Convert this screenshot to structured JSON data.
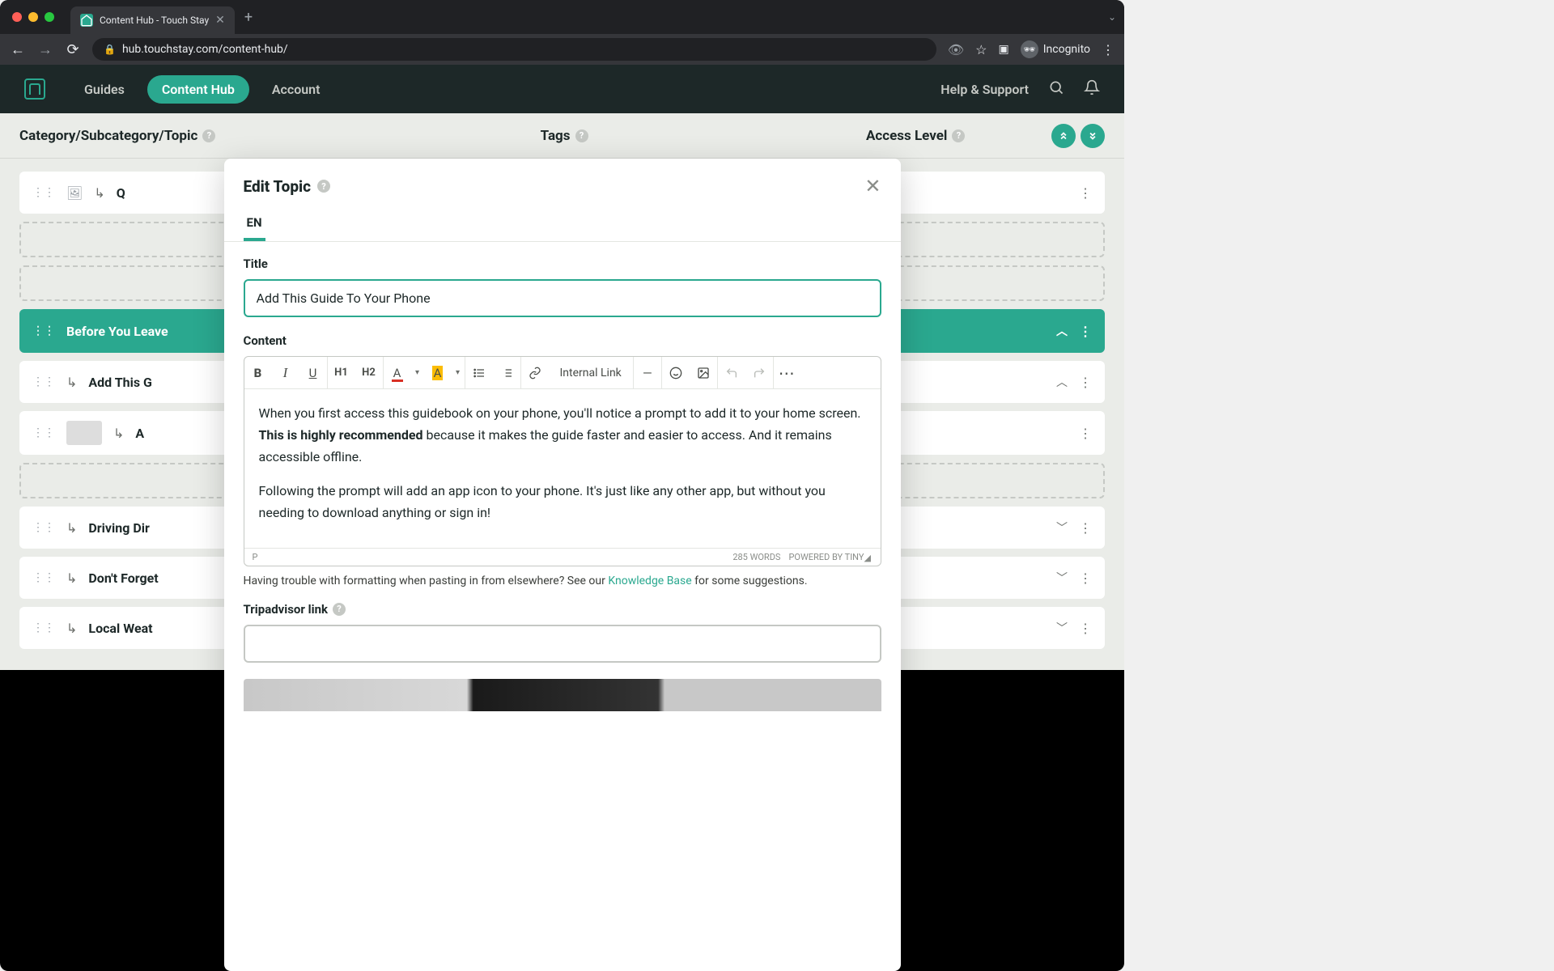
{
  "browser": {
    "tab_title": "Content Hub - Touch Stay",
    "url": "hub.touchstay.com/content-hub/",
    "incognito_label": "Incognito"
  },
  "nav": {
    "guides": "Guides",
    "content_hub": "Content Hub",
    "account": "Account",
    "help": "Help & Support"
  },
  "columns": {
    "category": "Category/Subcategory/Topic",
    "tags": "Tags",
    "access": "Access Level"
  },
  "rows": {
    "q_row": "Q",
    "before_you_leave": "Before You Leave",
    "add_this_g": "Add This G",
    "a_row": "A",
    "driving_dir": "Driving Dir",
    "dont_forget": "Don't Forget",
    "local_weat": "Local Weat"
  },
  "modal": {
    "title": "Edit Topic",
    "lang_tab": "EN",
    "title_label": "Title",
    "title_value": "Add This Guide To Your Phone",
    "content_label": "Content",
    "toolbar": {
      "bold": "B",
      "italic": "I",
      "underline": "U",
      "h1": "H1",
      "h2": "H2",
      "text_color": "A",
      "highlight": "A",
      "link": "🔗",
      "internal_link": "Internal Link",
      "hr": "—",
      "emoji": "☺",
      "image": "🖼",
      "undo": "↶",
      "redo": "↷",
      "more": "⋯"
    },
    "editor": {
      "p1_a": "When you first access this guidebook on your phone, you'll notice a prompt to add it to your home screen. ",
      "p1_bold": "This is highly recommended",
      "p1_b": " because it makes the guide faster and easier to access. And it remains accessible offline.",
      "p2": "Following the prompt will add an app icon to your phone. It's just like any other app, but without you needing to download anything or sign in!",
      "path": "P",
      "word_count": "285 WORDS",
      "powered": "POWERED BY TINY"
    },
    "help_text_a": "Having trouble with formatting when pasting in from elsewhere? See our ",
    "help_link": "Knowledge Base",
    "help_text_b": " for some suggestions.",
    "trip_label": "Tripadvisor link",
    "trip_value": ""
  }
}
